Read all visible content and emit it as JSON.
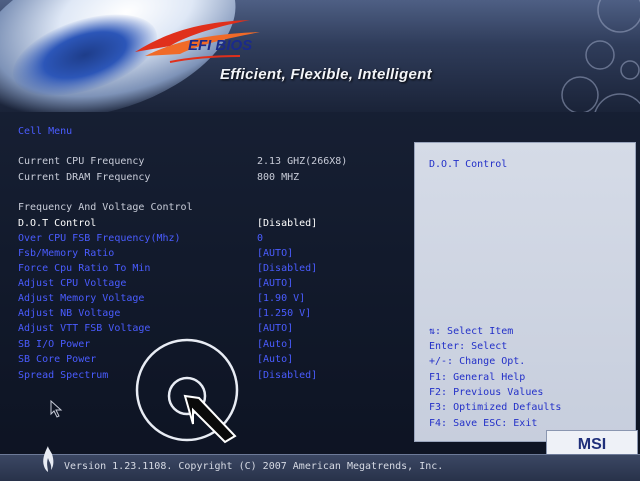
{
  "header": {
    "logo_text": "EFI BIOS",
    "tagline": "Efficient, Flexible, Intelligent"
  },
  "breadcrumb": "Cell Menu",
  "settings": [
    {
      "label": "Current CPU Frequency",
      "value": "2.13 GHZ(266X8)",
      "style": "static"
    },
    {
      "label": "Current DRAM Frequency",
      "value": "800 MHZ",
      "style": "static"
    },
    {
      "label": "Frequency And Voltage Control",
      "value": "",
      "style": "static"
    },
    {
      "label": "D.O.T Control",
      "value": "[Disabled]",
      "style": "selected"
    },
    {
      "label": "Over CPU FSB Frequency(Mhz)",
      "value": "0",
      "style": "link"
    },
    {
      "label": "Fsb/Memory Ratio",
      "value": "[AUTO]",
      "style": "link"
    },
    {
      "label": "Force Cpu Ratio To Min",
      "value": "[Disabled]",
      "style": "link"
    },
    {
      "label": "Adjust CPU Voltage",
      "value": "[AUTO]",
      "style": "link"
    },
    {
      "label": "Adjust Memory Voltage",
      "value": "[1.90 V]",
      "style": "link"
    },
    {
      "label": "Adjust NB Voltage",
      "value": "[1.250 V]",
      "style": "link"
    },
    {
      "label": "Adjust VTT FSB Voltage",
      "value": "[AUTO]",
      "style": "link"
    },
    {
      "label": "SB I/O Power",
      "value": "[Auto]",
      "style": "link"
    },
    {
      "label": "SB Core Power",
      "value": "[Auto]",
      "style": "link"
    },
    {
      "label": "Spread  Spectrum",
      "value": "[Disabled]",
      "style": "link"
    }
  ],
  "help": {
    "title": "D.O.T Control",
    "keys": [
      "⇅: Select Item",
      "Enter: Select",
      "+/-: Change Opt.",
      "F1: General Help",
      "F2: Previous Values",
      "F3: Optimized Defaults",
      "F4: Save  ESC: Exit"
    ]
  },
  "brand_badge": "MSI",
  "footer": {
    "version": "Version 1.23.1108. Copyright (C) 2007 American Megatrends, Inc."
  },
  "colors": {
    "link": "#4a5cff",
    "static": "#c8ccd8",
    "selected": "#ffffff",
    "help_text": "#2330c8"
  }
}
